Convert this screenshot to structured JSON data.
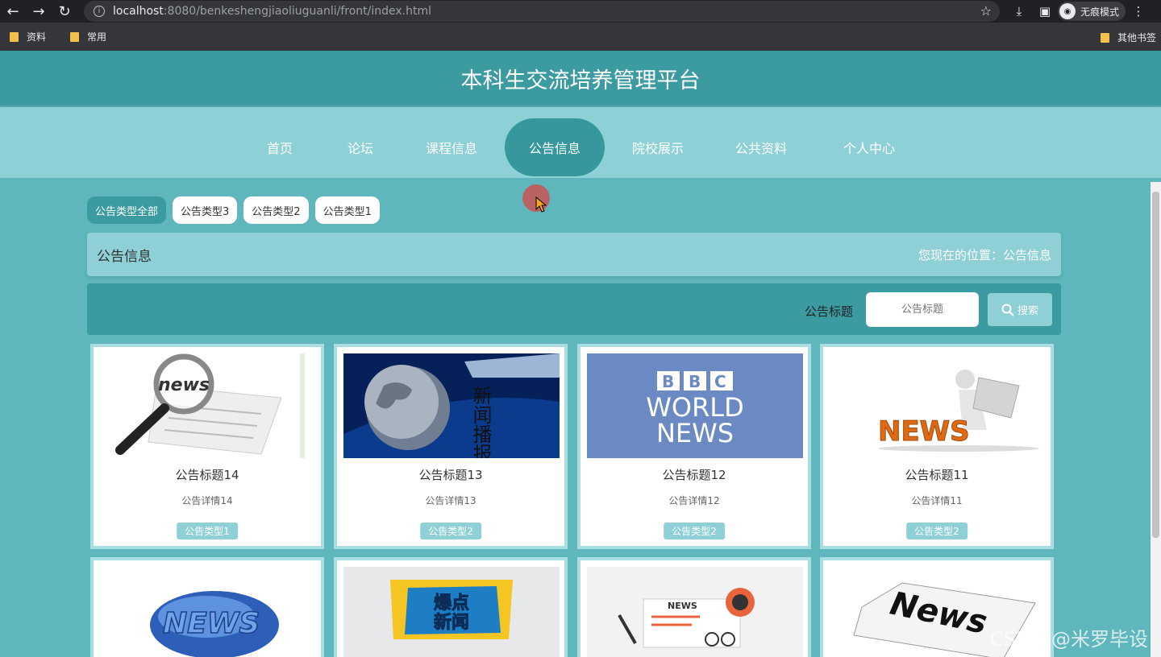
{
  "browser": {
    "url_host": "localhost",
    "url_rest": ":8080/benkeshengjiaoliuguanli/front/index.html",
    "incognito_label": "无痕模式",
    "bookmarks": [
      "资料",
      "常用"
    ],
    "other_bookmarks": "其他书签"
  },
  "site": {
    "title": "本科生交流培养管理平台",
    "nav": [
      "首页",
      "论坛",
      "课程信息",
      "公告信息",
      "院校展示",
      "公共资料",
      "个人中心"
    ]
  },
  "filters": [
    "公告类型全部",
    "公告类型3",
    "公告类型2",
    "公告类型1"
  ],
  "crumb": {
    "title": "公告信息",
    "location": "您现在的位置：公告信息"
  },
  "search": {
    "label": "公告标题",
    "placeholder": "公告标题",
    "button": "搜索"
  },
  "cards": [
    {
      "title": "公告标题14",
      "detail": "公告详情14",
      "tag": "公告类型1",
      "image": "news-magnifier"
    },
    {
      "title": "公告标题13",
      "detail": "公告详情13",
      "tag": "公告类型2",
      "image": "globe-broadcast"
    },
    {
      "title": "公告标题12",
      "detail": "公告详情12",
      "tag": "公告类型2",
      "image": "bbc-world-news"
    },
    {
      "title": "公告标题11",
      "detail": "公告详情11",
      "tag": "公告类型2",
      "image": "news-3d-man"
    },
    {
      "image": "news-globe"
    },
    {
      "image": "breaking-news"
    },
    {
      "image": "news-illustration"
    },
    {
      "image": "newspaper"
    }
  ],
  "image_text": {
    "news": "news",
    "globe_vertical": "新闻播报",
    "bbc_letters": [
      "B",
      "B",
      "C"
    ],
    "bbc_world": "WORLD",
    "bbc_news": "NEWS",
    "news_caps": "NEWS",
    "breaking_1": "爆点",
    "breaking_2": "新闻",
    "news_small": "NEWS",
    "news_paper": "News"
  },
  "watermark": "CSDN @米罗毕设"
}
